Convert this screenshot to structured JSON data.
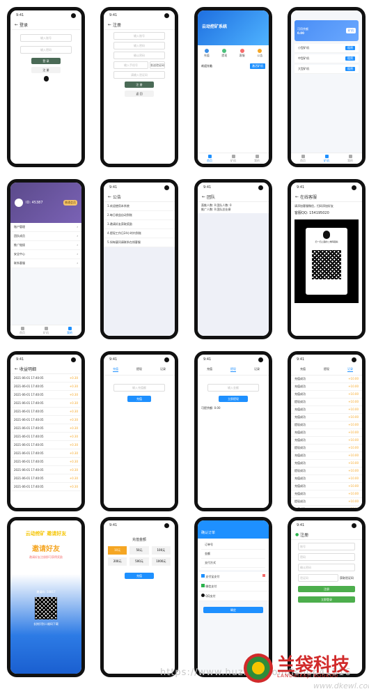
{
  "watermark_text": "https://www.huzhan.com/ishop41516",
  "brand": {
    "name": "兰袋科技",
    "sub": "LANDAIKEJI KOUKOU",
    "site": "www.dkewl.com"
  },
  "p1": {
    "title": "登录",
    "phone_ph": "输入账号",
    "pass_ph": "输入密码",
    "login": "登 录",
    "register": "注 册"
  },
  "p2": {
    "title": "注册",
    "f1": "输入账号",
    "f2": "输入密码",
    "f3": "确认密码",
    "f4": "输入手机号",
    "f5": "发送验证码",
    "f6": "请输入验证码",
    "submit": "注 册",
    "back": "返 回"
  },
  "p3": {
    "banner": "云动挖矿系统",
    "icons": [
      "充值",
      "提现",
      "客服",
      "公告"
    ],
    "notice": "欢迎光临",
    "btn": "激活矿机",
    "tabs": [
      "首页",
      "矿机",
      "我的"
    ]
  },
  "p4": {
    "balance_label": "可用余额",
    "balance": "0.00",
    "btn": "矿机",
    "items": [
      "小型矿机",
      "中型矿机",
      "大型矿机"
    ],
    "buy": "租赁"
  },
  "p5": {
    "user": "ID: 45387",
    "badge": "普通会员",
    "menu": [
      "账户管理",
      "团队成员",
      "推广链接",
      "安全中心",
      "联系客服"
    ]
  },
  "p6": {
    "title": "公告",
    "items": [
      "1.欢迎使用本系统",
      "2.每日收益自动到账",
      "3.邀请好友获取奖励",
      "4.提现工作日24小时内到账",
      "5.如有疑问请联系在线客服"
    ]
  },
  "p7": {
    "title": "团队",
    "line1": "直推人数: 0   团队人数: 0",
    "line2": "推广人数: 0   团队总业绩"
  },
  "p8": {
    "title": "在线客服",
    "text": "请添加客服微信，扫码添加好友",
    "qq": "客服QQ: 154195020",
    "scan": "扫一扫上面的二维码图案"
  },
  "p9": {
    "title": "收益明细",
    "rows": [
      {
        "d": "2021-06-01 17:40:05",
        "a": "+0.30"
      },
      {
        "d": "2021-06-01 17:40:05",
        "a": "+0.30"
      },
      {
        "d": "2021-06-01 17:40:05",
        "a": "+0.30"
      },
      {
        "d": "2021-06-01 17:40:05",
        "a": "+0.30"
      },
      {
        "d": "2021-06-01 17:40:05",
        "a": "+0.30"
      },
      {
        "d": "2021-06-01 17:40:05",
        "a": "+0.30"
      },
      {
        "d": "2021-06-01 17:40:05",
        "a": "+0.30"
      },
      {
        "d": "2021-06-01 17:40:05",
        "a": "+0.30"
      },
      {
        "d": "2021-06-01 17:40:05",
        "a": "+0.30"
      },
      {
        "d": "2021-06-01 17:40:05",
        "a": "+0.30"
      },
      {
        "d": "2021-06-01 17:40:05",
        "a": "+0.30"
      },
      {
        "d": "2021-06-01 17:40:05",
        "a": "+0.30"
      },
      {
        "d": "2021-06-01 17:40:05",
        "a": "+0.30"
      },
      {
        "d": "2021-06-01 17:40:05",
        "a": "+0.30"
      }
    ]
  },
  "p10": {
    "tabs": [
      "充值",
      "提现",
      "记录"
    ],
    "ph": "输入充值额",
    "btn": "充值"
  },
  "p11": {
    "tabs": [
      "充值",
      "提现",
      "记录"
    ],
    "ph": "输入金额",
    "btn": "立即提现",
    "info": "可提余额: 0.00"
  },
  "p12": {
    "tabs": [
      "充值",
      "提现",
      "记录"
    ],
    "rows": [
      "充值成功",
      "充值成功",
      "充值成功",
      "提现成功",
      "充值成功",
      "充值成功",
      "提现成功",
      "充值成功",
      "充值成功",
      "提现成功",
      "充值成功",
      "充值成功",
      "提现成功",
      "充值成功",
      "充值成功",
      "充值成功",
      "提现成功",
      "充值成功"
    ],
    "amt": "+10.00"
  },
  "p13": {
    "title": "云动挖矿 邀请好友",
    "headline": "邀请好友",
    "sub": "邀请好友注册即可获得奖励",
    "code_label": "邀请码: 50817",
    "foot": "长按识别二维码下载"
  },
  "p14": {
    "title": "充值金额",
    "amounts": [
      "10元",
      "50元",
      "100元",
      "200元",
      "500元",
      "1000元"
    ],
    "btn": "充值"
  },
  "p15": {
    "title": "确认订单",
    "rows": [
      "订单号",
      "金额",
      "支付方式"
    ],
    "pay": [
      "支付宝支付",
      "微信支付",
      "QQ支付"
    ],
    "btn": "确定"
  },
  "p16": {
    "title": "注册",
    "f": [
      "账号",
      "密码",
      "确认密码",
      "验证码"
    ],
    "code": "获取验证码",
    "btn": "注册",
    "btn2": "立即登录"
  }
}
